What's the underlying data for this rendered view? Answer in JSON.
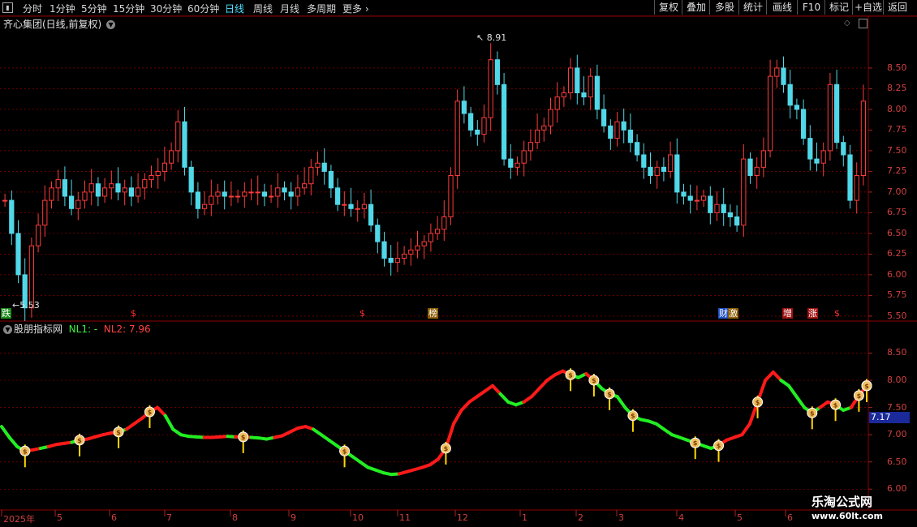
{
  "toolbar": {
    "periods": [
      "分时",
      "1分钟",
      "5分钟",
      "15分钟",
      "30分钟",
      "60分钟",
      "日线",
      "周线",
      "月线",
      "多周期",
      "更多"
    ],
    "active_period": "日线",
    "right_buttons": [
      "复权",
      "叠加",
      "多股",
      "统计",
      "画线",
      "F10",
      "标记",
      "+自选",
      "返回"
    ]
  },
  "stock": {
    "title": "齐心集团(日线,前复权)"
  },
  "price_panel": {
    "y_labels": [
      "8.50",
      "8.25",
      "8.00",
      "7.75",
      "7.50",
      "7.25",
      "7.00",
      "6.75",
      "6.50",
      "6.25",
      "6.00",
      "5.75",
      "5.50"
    ],
    "high_label": "8.91",
    "low_label": "5.53",
    "event_tags": [
      {
        "text": "跌",
        "kind": "green"
      },
      {
        "text": "$",
        "kind": "dollar"
      },
      {
        "text": "$",
        "kind": "dollar"
      },
      {
        "text": "榜",
        "kind": "orange"
      },
      {
        "text": "财",
        "kind": "blue"
      },
      {
        "text": "激",
        "kind": "orange"
      },
      {
        "text": "增",
        "kind": "red"
      },
      {
        "text": "涨",
        "kind": "red"
      },
      {
        "text": "$",
        "kind": "dollar"
      }
    ]
  },
  "indicator": {
    "name": "股朋指标网",
    "nl1_label": "NL1: -",
    "nl2_label": "NL2: 7.96",
    "y_labels": [
      "8.50",
      "8.00",
      "7.50",
      "7.00",
      "6.50",
      "6.00"
    ],
    "current_value": "7.17"
  },
  "x_axis": {
    "labels": [
      "2025年",
      "5",
      "6",
      "7",
      "8",
      "9",
      "10",
      "11",
      "12",
      "1",
      "2",
      "3",
      "4",
      "5",
      "6"
    ]
  },
  "watermark": {
    "title": "乐淘公式网",
    "url": "www.60lt.com"
  },
  "colors": {
    "up": "#ff3b3b",
    "down": "#50d8e8",
    "nl_up": "#ff1a1a",
    "nl_down": "#22ee22",
    "grid": "#8b0000",
    "signal": "#ffd800"
  },
  "chart_data": {
    "type": "candlestick+line",
    "price_ylim": [
      5.45,
      8.95
    ],
    "price_series": [
      6.9,
      6.5,
      6.0,
      5.6,
      6.35,
      6.6,
      6.9,
      7.05,
      7.15,
      6.95,
      6.8,
      6.9,
      7.0,
      7.1,
      6.95,
      7.05,
      7.1,
      7.0,
      7.05,
      6.95,
      7.05,
      7.15,
      7.2,
      7.25,
      7.35,
      7.5,
      7.85,
      7.3,
      7.0,
      6.8,
      6.85,
      6.95,
      7.0,
      6.95,
      6.95,
      6.95,
      7.0,
      7.0,
      7.0,
      6.95,
      6.95,
      7.05,
      7.0,
      6.95,
      7.05,
      7.1,
      7.3,
      7.35,
      7.25,
      7.05,
      6.85,
      6.85,
      6.8,
      6.8,
      6.85,
      6.6,
      6.4,
      6.2,
      6.15,
      6.2,
      6.25,
      6.3,
      6.35,
      6.4,
      6.5,
      6.55,
      6.7,
      7.2,
      8.1,
      7.95,
      7.75,
      7.7,
      7.9,
      8.6,
      8.3,
      7.4,
      7.3,
      7.35,
      7.5,
      7.6,
      7.75,
      7.8,
      8.0,
      8.15,
      8.2,
      8.5,
      8.2,
      8.15,
      8.4,
      8.0,
      7.8,
      7.65,
      7.85,
      7.75,
      7.6,
      7.45,
      7.3,
      7.2,
      7.3,
      7.25,
      7.45,
      7.0,
      6.95,
      6.9,
      6.9,
      6.95,
      6.75,
      6.85,
      6.75,
      6.7,
      6.6,
      7.4,
      7.2,
      7.3,
      7.5,
      8.4,
      8.5,
      8.3,
      8.05,
      8.0,
      7.65,
      7.4,
      7.35,
      7.5,
      8.3,
      7.6,
      7.45,
      6.9,
      7.2,
      8.1
    ],
    "nl_ylim": [
      5.9,
      8.85
    ],
    "nl_series": [
      7.15,
      6.95,
      6.78,
      6.7,
      6.72,
      6.75,
      6.78,
      6.82,
      6.84,
      6.86,
      6.9,
      6.92,
      6.96,
      7.0,
      7.03,
      7.05,
      7.1,
      7.2,
      7.3,
      7.42,
      7.5,
      7.35,
      7.1,
      7.0,
      6.97,
      6.96,
      6.95,
      6.95,
      6.96,
      6.97,
      6.96,
      6.96,
      6.95,
      6.94,
      6.92,
      6.95,
      6.98,
      7.05,
      7.12,
      7.15,
      7.1,
      7.0,
      6.9,
      6.8,
      6.7,
      6.6,
      6.5,
      6.4,
      6.35,
      6.3,
      6.27,
      6.28,
      6.32,
      6.36,
      6.4,
      6.45,
      6.55,
      6.75,
      7.2,
      7.45,
      7.6,
      7.7,
      7.8,
      7.9,
      7.75,
      7.6,
      7.55,
      7.6,
      7.7,
      7.85,
      8.0,
      8.1,
      8.17,
      8.1,
      8.05,
      8.12,
      8.0,
      7.85,
      7.75,
      7.7,
      7.5,
      7.35,
      7.28,
      7.25,
      7.2,
      7.1,
      7.0,
      6.95,
      6.9,
      6.85,
      6.8,
      6.75,
      6.8,
      6.9,
      6.95,
      7.0,
      7.2,
      7.6,
      8.0,
      8.15,
      8.0,
      7.9,
      7.7,
      7.5,
      7.4,
      7.5,
      7.6,
      7.55,
      7.45,
      7.5,
      7.72,
      7.9
    ],
    "nl_direction": [
      "d",
      "d",
      "d",
      "u",
      "u",
      "d",
      "u",
      "u",
      "u",
      "d",
      "u",
      "u",
      "u",
      "u",
      "u",
      "d",
      "u",
      "u",
      "u",
      "u",
      "u",
      "d",
      "d",
      "d",
      "d",
      "d",
      "u",
      "u",
      "u",
      "d",
      "u",
      "u",
      "d",
      "d",
      "d",
      "u",
      "u",
      "u",
      "u",
      "u",
      "d",
      "d",
      "d",
      "d",
      "d",
      "d",
      "d",
      "d",
      "d",
      "d",
      "d",
      "u",
      "u",
      "u",
      "u",
      "u",
      "u",
      "u",
      "u",
      "u",
      "u",
      "u",
      "u",
      "u",
      "d",
      "d",
      "d",
      "u",
      "u",
      "u",
      "u",
      "u",
      "u",
      "d",
      "d",
      "u",
      "d",
      "d",
      "d",
      "d",
      "d",
      "d",
      "d",
      "d",
      "d",
      "d",
      "d",
      "d",
      "d",
      "d",
      "d",
      "d",
      "u",
      "u",
      "u",
      "u",
      "u",
      "u",
      "u",
      "u",
      "d",
      "d",
      "d",
      "d",
      "d",
      "u",
      "u",
      "d",
      "d",
      "u",
      "u",
      "u"
    ],
    "signals": [
      3,
      10,
      15,
      19,
      31,
      44,
      57,
      73,
      76,
      78,
      81,
      89,
      92,
      97,
      104,
      107,
      110,
      115,
      120,
      130,
      133,
      137
    ]
  }
}
